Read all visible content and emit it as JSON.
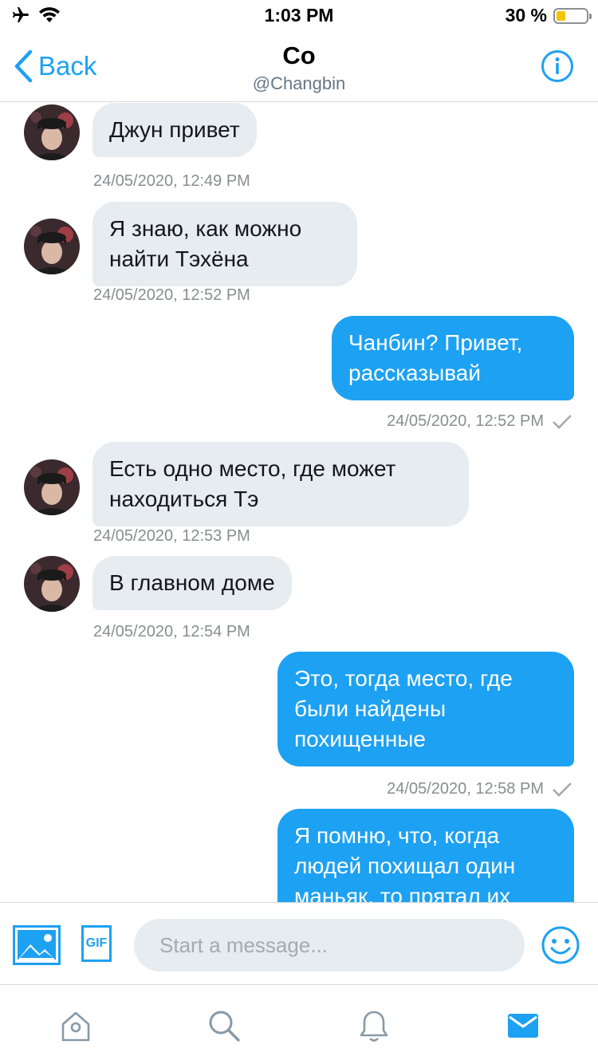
{
  "status_bar": {
    "time": "1:03 PM",
    "battery_percent": "30 %",
    "battery_level": 0.3
  },
  "header": {
    "back_label": "Back",
    "title": "Co",
    "handle": "@Changbin"
  },
  "messages": [
    {
      "side": "in",
      "text": "Джун привет",
      "timestamp": "24/05/2020, 12:49 PM"
    },
    {
      "side": "in",
      "text": "Я знаю, как можно найти Тэхёна",
      "timestamp": "24/05/2020, 12:52 PM"
    },
    {
      "side": "out",
      "text": "Чанбин? Привет, рассказывай",
      "timestamp": "24/05/2020, 12:52 PM",
      "read": true
    },
    {
      "side": "in",
      "text": "Есть одно место, где может находиться Тэ",
      "timestamp": "24/05/2020, 12:53 PM"
    },
    {
      "side": "in",
      "text": "В главном доме",
      "timestamp": "24/05/2020, 12:54 PM"
    },
    {
      "side": "out",
      "text": "Это, тогда место, где были найдены похищенные",
      "timestamp": "24/05/2020, 12:58 PM",
      "read": true
    },
    {
      "side": "out",
      "text": "Я помню, что, когда людей похищал один маньяк, то прятал их"
    }
  ],
  "composer": {
    "placeholder": "Start a message...",
    "gif_label": "GIF"
  },
  "colors": {
    "accent": "#1da1f2",
    "incoming_bubble": "#e6ecf0",
    "timestamp": "#8a8d91",
    "battery": "#f5c400"
  },
  "icons": {
    "media": "image-icon",
    "gif": "gif-icon",
    "emoji": "emoji-icon",
    "info": "info-icon",
    "tabs": [
      "home-icon",
      "search-icon",
      "notifications-icon",
      "messages-icon"
    ]
  }
}
